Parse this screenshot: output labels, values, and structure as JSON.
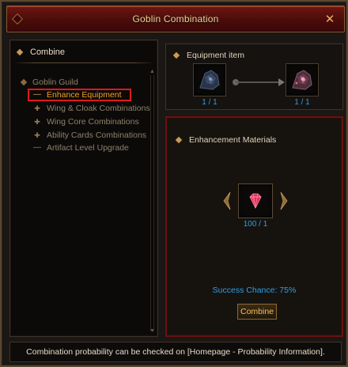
{
  "window": {
    "title": "Goblin Combination",
    "close_icon": "close-icon",
    "accent_color": "#6e1612"
  },
  "left_panel": {
    "header": "Combine",
    "tree": {
      "root": {
        "label": "Goblin Guild",
        "icon": "folder-icon"
      },
      "items": [
        {
          "label": "Enhance Equipment",
          "icon": "minus-icon",
          "selected": true
        },
        {
          "label": "Wing & Cloak Combinations",
          "icon": "plus-icon",
          "selected": false
        },
        {
          "label": "Wing Core Combinations",
          "icon": "plus-icon",
          "selected": false
        },
        {
          "label": "Ability Cards Combinations",
          "icon": "plus-icon",
          "selected": false
        },
        {
          "label": "Artifact Level Upgrade",
          "icon": "minus-icon",
          "selected": false
        }
      ]
    }
  },
  "equipment": {
    "header": "Equipment item",
    "source": {
      "count": "1 / 1",
      "icon": "equipment-icon"
    },
    "result": {
      "count": "1 / 1",
      "icon": "enhanced-equipment-icon"
    }
  },
  "materials": {
    "header": "Enhancement Materials",
    "item": {
      "count": "100 / 1",
      "icon": "gem-icon"
    },
    "success_chance": "Success Chance: 75%",
    "combine_label": "Combine"
  },
  "footer": {
    "text": "Combination probability can be checked on [Homepage - Probability Information]."
  },
  "colors": {
    "count_blue": "#2e9fe6",
    "selected_border": "#e01818",
    "selected_text": "#f0a020"
  }
}
